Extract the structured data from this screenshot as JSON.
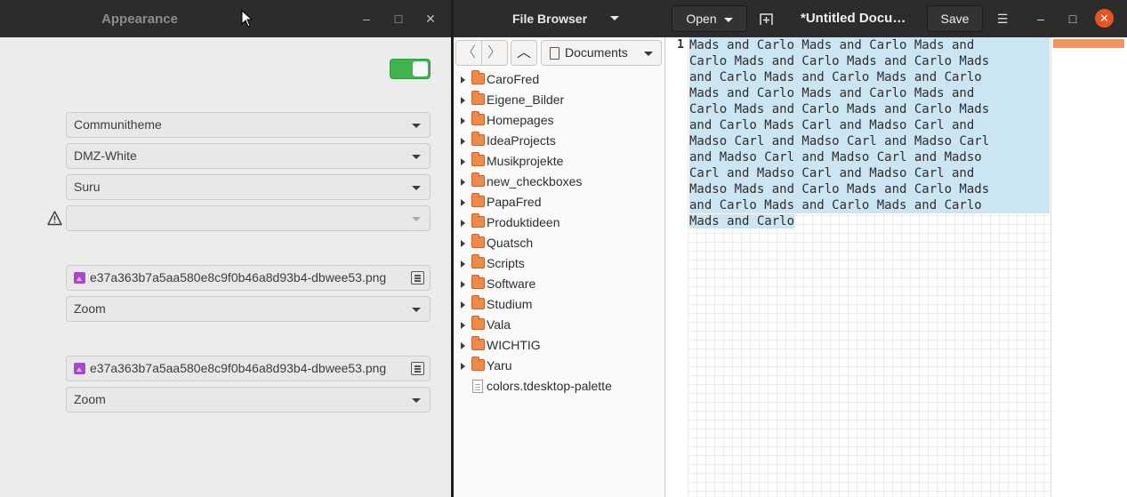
{
  "appearance": {
    "title": "Appearance",
    "window_controls": {
      "minimize": "–",
      "maximize": "□",
      "close": "✕"
    },
    "toggle_on": true,
    "combos": [
      {
        "value": "Communitheme"
      },
      {
        "value": "DMZ-White"
      },
      {
        "value": "Suru"
      },
      {
        "value": ""
      }
    ],
    "files": [
      {
        "value": "e37a363b7a5aa580e8c9f0b46a8d93b4-dbwee53.png",
        "mode": "Zoom"
      },
      {
        "value": "e37a363b7a5aa580e8c9f0b46a8d93b4-dbwee53.png",
        "mode": "Zoom"
      }
    ]
  },
  "gedit": {
    "panel_title": "File Browser",
    "open_label": "Open",
    "doc_title": "*Untitled Docu…",
    "save_label": "Save",
    "menu_icon": "☰",
    "controls": {
      "minimize": "–",
      "maximize": "□",
      "close": "✕"
    },
    "nav": {
      "back": "〈",
      "forward": "〉",
      "up": "︿"
    },
    "location": "Documents",
    "tree": [
      {
        "name": "CaroFred",
        "type": "folder"
      },
      {
        "name": "Eigene_Bilder",
        "type": "folder"
      },
      {
        "name": "Homepages",
        "type": "folder"
      },
      {
        "name": "IdeaProjects",
        "type": "folder"
      },
      {
        "name": "Musikprojekte",
        "type": "folder"
      },
      {
        "name": "new_checkboxes",
        "type": "folder"
      },
      {
        "name": "PapaFred",
        "type": "folder"
      },
      {
        "name": "Produktideen",
        "type": "folder"
      },
      {
        "name": "Quatsch",
        "type": "folder"
      },
      {
        "name": "Scripts",
        "type": "folder"
      },
      {
        "name": "Software",
        "type": "folder"
      },
      {
        "name": "Studium",
        "type": "folder"
      },
      {
        "name": "Vala",
        "type": "folder"
      },
      {
        "name": "WICHTIG",
        "type": "folder"
      },
      {
        "name": "Yaru",
        "type": "folder"
      },
      {
        "name": "colors.tdesktop-palette",
        "type": "file"
      }
    ],
    "line_number": "1",
    "text_lines": [
      "Mads and Carlo Mads and Carlo Mads and",
      "Carlo Mads and Carlo Mads and Carlo Mads",
      "and Carlo Mads and Carlo Mads and Carlo",
      "Mads and Carlo Mads and Carlo Mads and",
      "Carlo Mads and Carlo Mads and Carlo Mads",
      "and Carlo Mads Carl and Madso Carl and",
      "Madso Carl and Madso Carl and Madso Carl",
      "and Madso Carl and Madso Carl and Madso",
      "Carl and Madso Carl and Madso Carl and",
      "Madso Mads and Carlo Mads and Carlo Mads",
      "and Carlo Mads and Carlo Mads and Carlo",
      "Mads and Carlo"
    ]
  }
}
